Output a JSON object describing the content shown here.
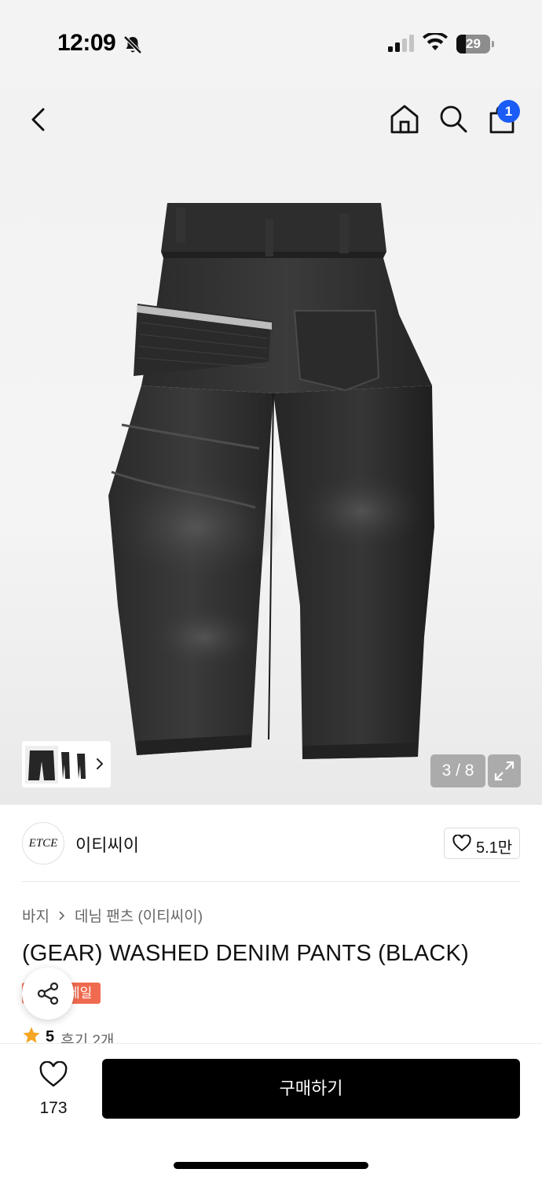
{
  "status_bar": {
    "time": "12:09",
    "battery_percent": "29",
    "battery_level": 0.29,
    "signal_bars_active": 2,
    "signal_bars_total": 4,
    "icons": [
      "bell-slash-icon",
      "signal-icon",
      "wifi-icon",
      "battery-icon"
    ]
  },
  "nav": {
    "icons": [
      "back-chevron-icon",
      "home-icon",
      "search-icon",
      "shopping-bag-icon"
    ],
    "cart_count": "1",
    "badge_color": "#1a5cf5"
  },
  "gallery": {
    "image_description_icon": "black-denim-pants-back-view",
    "page_indicator": "3 / 8",
    "expand_icon": "expand-arrows-icon",
    "thumbnail_chevron_icon": "chevron-right-icon"
  },
  "brand": {
    "logo_text": "ETCE",
    "name": "이티씨이",
    "like_count": "5.1만",
    "like_icon": "heart-outline-icon"
  },
  "breadcrumb": {
    "items": [
      "바지",
      "데님 팬츠 (이티씨이)"
    ]
  },
  "product": {
    "title": "(GEAR) WASHED DENIM PANTS (BLACK)",
    "badge_label": "세일",
    "badge_color": "#f06a4f",
    "rating": "5",
    "review_text": "후기 2개",
    "rating_icon_color": "#f5a623"
  },
  "bottom_bar": {
    "wishlist_count": "173",
    "buy_label": "구매하기"
  }
}
